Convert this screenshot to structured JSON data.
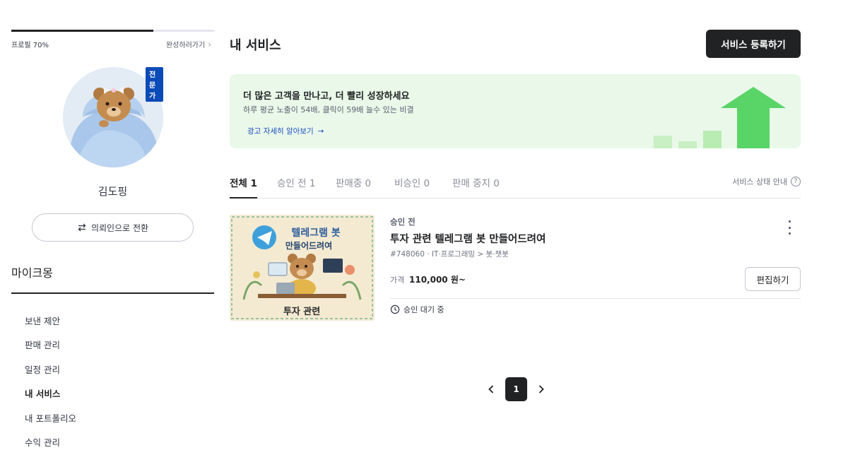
{
  "sidebar": {
    "profile_progress_label": "프로필 70%",
    "profile_progress": 0.7,
    "complete_link": "완성하러가기",
    "expert_badge": "전문가",
    "user_name": "김도핑",
    "switch_button": "의뢰인으로 전환",
    "section_title": "마이크몽",
    "menu": [
      {
        "label": "보낸 제안",
        "active": false
      },
      {
        "label": "판매 관리",
        "active": false
      },
      {
        "label": "일정 관리",
        "active": false
      },
      {
        "label": "내 서비스",
        "active": true
      },
      {
        "label": "내 포트폴리오",
        "active": false
      },
      {
        "label": "수익 관리",
        "active": false
      }
    ]
  },
  "main": {
    "page_title": "내 서비스",
    "register_button": "서비스 등록하기",
    "promo": {
      "title": "더 많은 고객을 만나고, 더 빨리 성장하세요",
      "subtitle": "하루 평균 노출이 54배, 클릭이 59배 늘수 있는 비결",
      "link": "광고 자세히 알아보기"
    },
    "tabs": [
      {
        "label": "전체 1",
        "active": true
      },
      {
        "label": "승인 전 1",
        "active": false
      },
      {
        "label": "판매중 0",
        "active": false
      },
      {
        "label": "비승인 0",
        "active": false
      },
      {
        "label": "판매 중지 0",
        "active": false
      }
    ],
    "status_guide": "서비스 상태 안내",
    "service": {
      "status": "승인 전",
      "title": "투자 관련 텔레그램 봇 만들어드려여",
      "meta": "#748060 · IT·프로그래밍 > 봇·챗봇",
      "price_label": "가격",
      "price_value": "110,000 원~",
      "edit_button": "편집하기",
      "pending_text": "승인 대기 중",
      "thumb_title_line1": "텔레그램 봇",
      "thumb_title_line2": "만들어드려여",
      "thumb_caption": "투자 관련"
    },
    "pagination": {
      "current_page": "1"
    }
  },
  "colors": {
    "primary_dark": "#212224",
    "promo_bg": "#e9f8e9",
    "arrow_green": "#59d466",
    "link_blue": "#1b4bc4",
    "badge_blue": "#0b4bb8"
  }
}
